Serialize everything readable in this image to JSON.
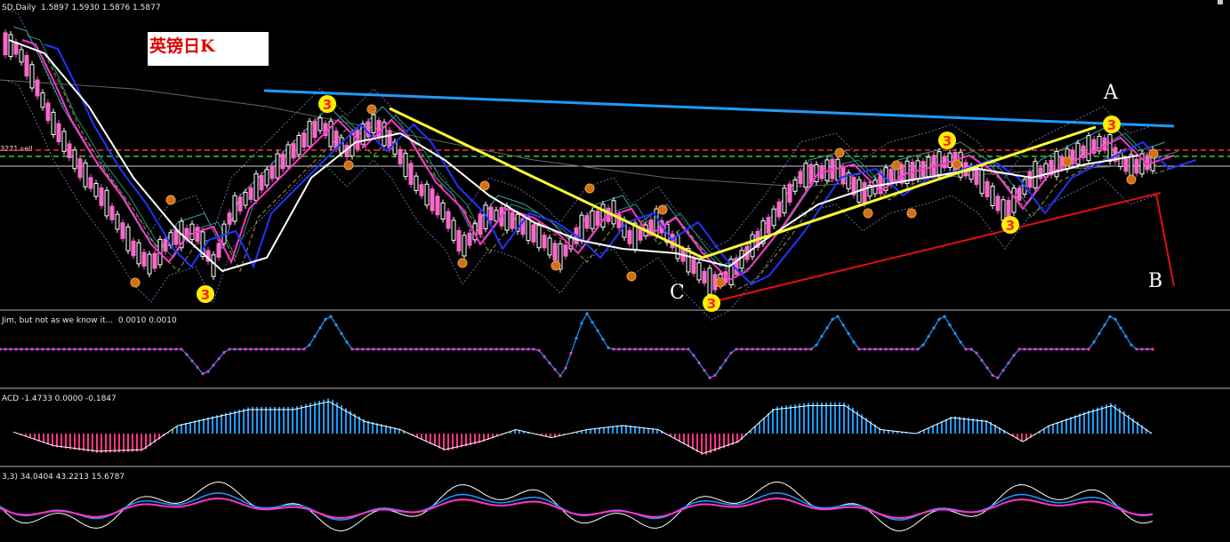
{
  "main_chart": {
    "header": "SD,Daily  1.5897 1.5930 1.5876 1.5877",
    "label_box": "英镑日K",
    "price_tag": "3271 sell",
    "wave_letters": [
      "A",
      "B",
      "C"
    ],
    "wave_count_label": "3"
  },
  "indicator_1": {
    "header": "Jim, but not as we know it...  0.0010 0.0010"
  },
  "indicator_2": {
    "header": "ACD -1.4733 0.0000 -0.1847"
  },
  "indicator_3": {
    "header": "3,3) 34.0404 43.2213 15.6787"
  },
  "colors": {
    "background": "#000000",
    "bull_candle": "#ffffff",
    "bear_candle": "#ff66cc",
    "trend_blue": "#1e9bff",
    "trend_yellow": "#ffff33",
    "trend_red": "#e01010",
    "ma_magenta": "#ff33cc",
    "ma_blue": "#2233ff",
    "ma_white": "#ffffff"
  }
}
